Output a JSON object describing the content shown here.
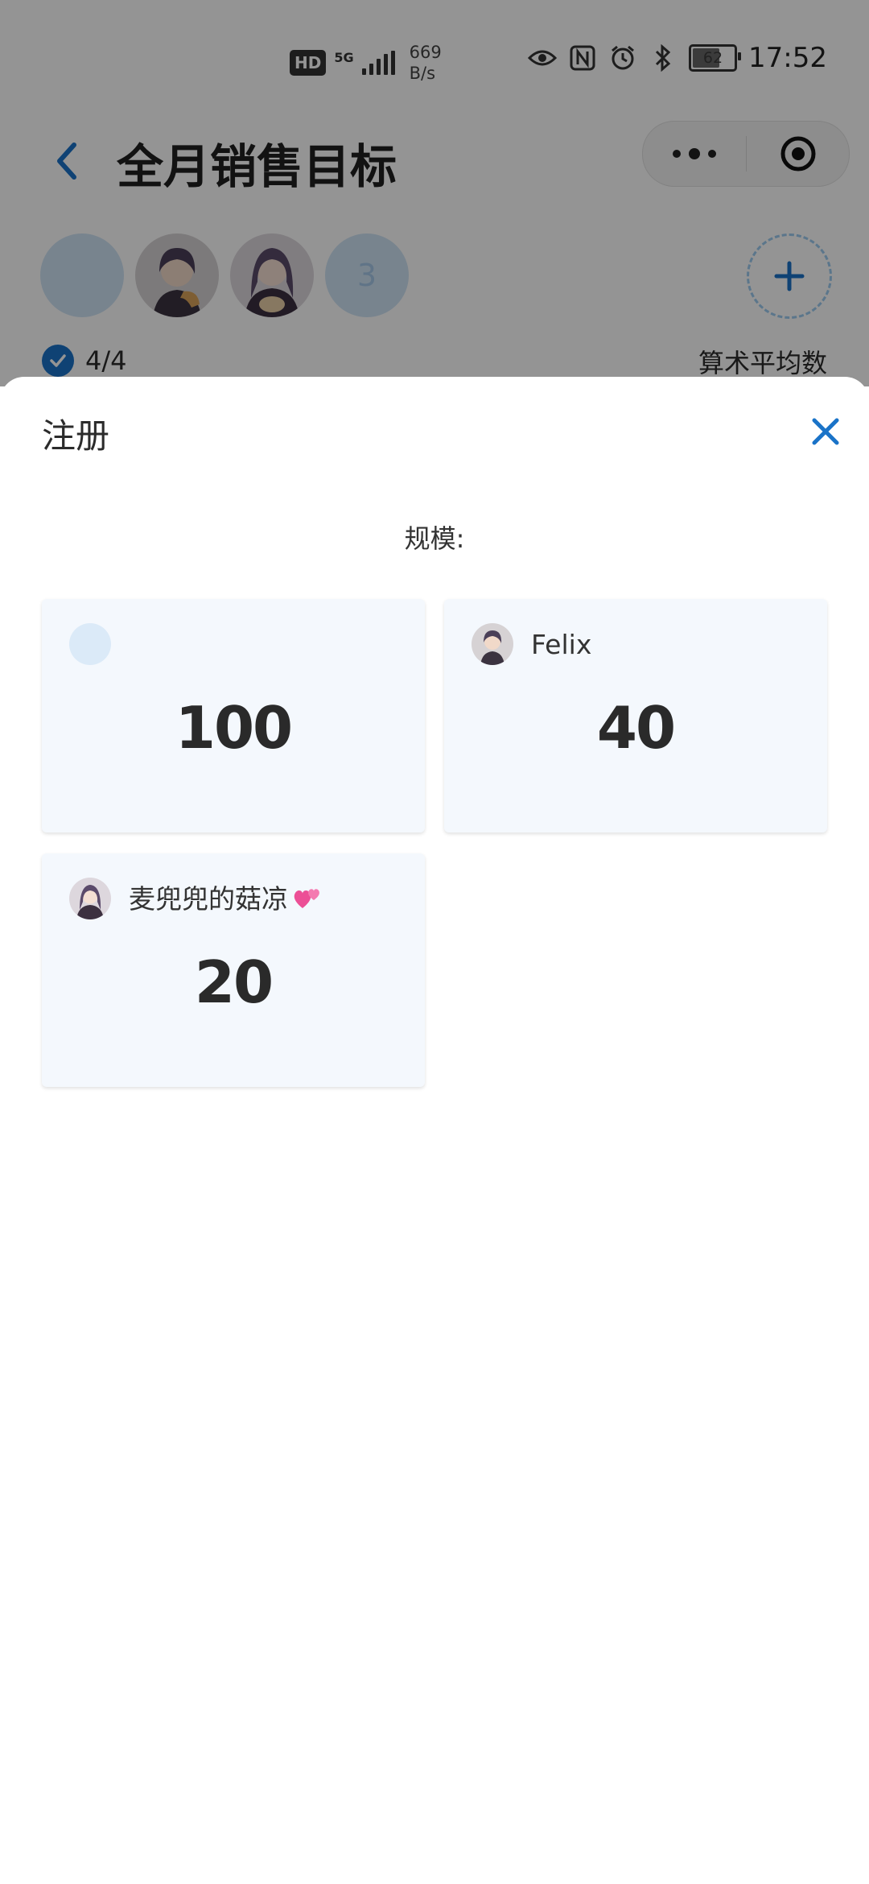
{
  "status_bar": {
    "hd": "HD",
    "network": "5G",
    "speed_value": "669",
    "speed_unit": "B/s",
    "battery": "62",
    "time": "17:52",
    "icons": [
      "eye-icon",
      "nfc-icon",
      "alarm-icon",
      "bluetooth-icon"
    ]
  },
  "nav": {
    "title": "全月销售目标"
  },
  "members": {
    "extra_count": "3"
  },
  "progress": {
    "text": "4/4",
    "avg_label": "算术平均数"
  },
  "sheet": {
    "title": "注册",
    "scale_label": "规模:",
    "cards": [
      {
        "name": "",
        "value": "100"
      },
      {
        "name": "Felix",
        "value": "40"
      },
      {
        "name": "麦兜兜的菇凉",
        "value": "20"
      }
    ]
  },
  "colors": {
    "accent": "#1a73c8",
    "card_bg": "#f4f8fd",
    "overlay": "rgba(0,0,0,0.42)"
  }
}
